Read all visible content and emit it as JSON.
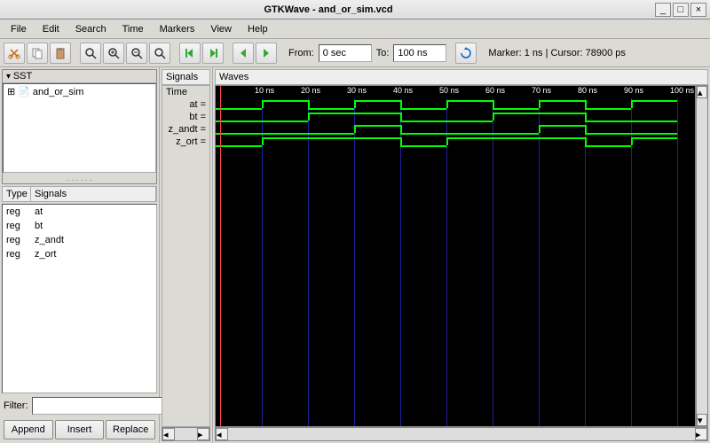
{
  "title": "GTKWave - and_or_sim.vcd",
  "menu": [
    "File",
    "Edit",
    "Search",
    "Time",
    "Markers",
    "View",
    "Help"
  ],
  "toolbar": {
    "from_label": "From:",
    "from_value": "0 sec",
    "to_label": "To:",
    "to_value": "100 ns",
    "marker_cursor": "Marker: 1 ns | Cursor: 78900 ps"
  },
  "sst": {
    "title": "SST",
    "root": "and_or_sim"
  },
  "sig_table": {
    "head_type": "Type",
    "head_signals": "Signals",
    "rows": [
      {
        "type": "reg",
        "name": "at"
      },
      {
        "type": "reg",
        "name": "bt"
      },
      {
        "type": "reg",
        "name": "z_andt"
      },
      {
        "type": "reg",
        "name": "z_ort"
      }
    ]
  },
  "filter_label": "Filter:",
  "filter_value": "",
  "buttons": {
    "append": "Append",
    "insert": "Insert",
    "replace": "Replace"
  },
  "signals_panel": {
    "title": "Signals",
    "time_label": "Time",
    "items": [
      "at =",
      "bt =",
      "z_andt =",
      "z_ort ="
    ]
  },
  "waves": {
    "title": "Waves",
    "ticks": [
      "10 ns",
      "20 ns",
      "30 ns",
      "40 ns",
      "50 ns",
      "60 ns",
      "70 ns",
      "80 ns",
      "90 ns",
      "100 ns"
    ],
    "marker_ns": 1,
    "range_ns": 100,
    "signals": [
      {
        "name": "at",
        "transitions": [
          {
            "t": 0,
            "v": 0
          },
          {
            "t": 10,
            "v": 1
          },
          {
            "t": 20,
            "v": 0
          },
          {
            "t": 30,
            "v": 1
          },
          {
            "t": 40,
            "v": 0
          },
          {
            "t": 50,
            "v": 1
          },
          {
            "t": 60,
            "v": 0
          },
          {
            "t": 70,
            "v": 1
          },
          {
            "t": 80,
            "v": 0
          },
          {
            "t": 90,
            "v": 1
          }
        ]
      },
      {
        "name": "bt",
        "transitions": [
          {
            "t": 0,
            "v": 0
          },
          {
            "t": 20,
            "v": 1
          },
          {
            "t": 40,
            "v": 0
          },
          {
            "t": 60,
            "v": 1
          },
          {
            "t": 80,
            "v": 0
          }
        ]
      },
      {
        "name": "z_andt",
        "transitions": [
          {
            "t": 0,
            "v": 0
          },
          {
            "t": 30,
            "v": 1
          },
          {
            "t": 40,
            "v": 0
          },
          {
            "t": 70,
            "v": 1
          },
          {
            "t": 80,
            "v": 0
          }
        ]
      },
      {
        "name": "z_ort",
        "transitions": [
          {
            "t": 0,
            "v": 0
          },
          {
            "t": 10,
            "v": 1
          },
          {
            "t": 40,
            "v": 0
          },
          {
            "t": 50,
            "v": 1
          },
          {
            "t": 80,
            "v": 0
          },
          {
            "t": 90,
            "v": 1
          }
        ]
      }
    ]
  }
}
